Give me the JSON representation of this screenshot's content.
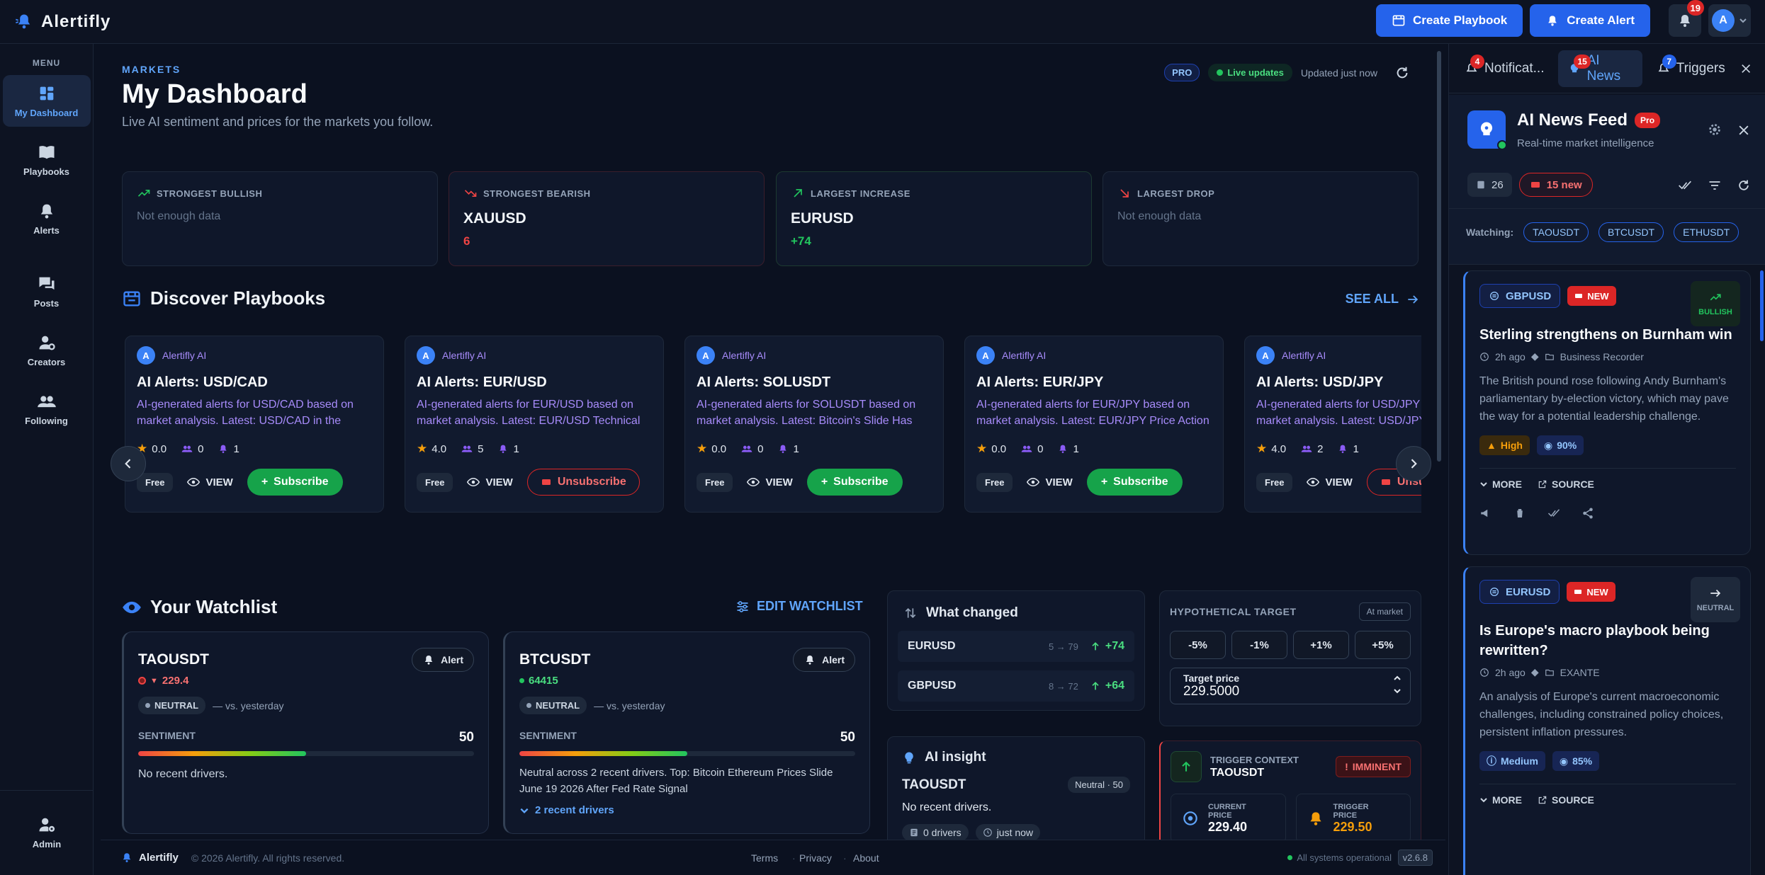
{
  "app": {
    "name": "Alertifly"
  },
  "header": {
    "create_playbook": "Create Playbook",
    "create_alert": "Create Alert",
    "notifications_count": "19",
    "avatar_initial": "A"
  },
  "sidebar": {
    "menu_title": "MENU",
    "items": [
      {
        "label": "My Dashboard"
      },
      {
        "label": "Playbooks"
      },
      {
        "label": "Alerts"
      },
      {
        "label": "Posts"
      },
      {
        "label": "Creators"
      },
      {
        "label": "Following"
      }
    ],
    "admin_label": "Admin"
  },
  "page": {
    "section_label": "MARKETS",
    "title": "My Dashboard",
    "subtitle": "Live AI sentiment and prices for the markets you follow.",
    "pro_badge": "PRO",
    "live_label": "Live updates",
    "updated_label": "Updated just now"
  },
  "stats": [
    {
      "label": "STRONGEST BULLISH",
      "empty": "Not enough data"
    },
    {
      "label": "STRONGEST BEARISH",
      "symbol": "XAUUSD",
      "value": "6"
    },
    {
      "label": "LARGEST INCREASE",
      "symbol": "EURUSD",
      "value": "+74"
    },
    {
      "label": "LARGEST DROP",
      "empty": "Not enough data"
    }
  ],
  "playbooks": {
    "title": "Discover Playbooks",
    "see_all": "SEE ALL",
    "author": "Alertifly AI",
    "author_initial": "A",
    "free_label": "Free",
    "view_label": "VIEW",
    "subscribe_label": "Subscribe",
    "unsubscribe_label": "Unsubscribe",
    "cards": [
      {
        "title": "AI Alerts: USD/CAD",
        "desc": "AI-generated alerts for USD/CAD based on market analysis. Latest: USD/CAD in the Spotlight",
        "rating": "0.0",
        "subs": "0",
        "alerts": "1",
        "action": "subscribe"
      },
      {
        "title": "AI Alerts: EUR/USD",
        "desc": "AI-generated alerts for EUR/USD based on market analysis. Latest: EUR/USD Technical Outlook",
        "rating": "4.0",
        "subs": "5",
        "alerts": "1",
        "action": "unsubscribe"
      },
      {
        "title": "AI Alerts: SOLUSDT",
        "desc": "AI-generated alerts for SOLUSDT based on market analysis. Latest: Bitcoin's Slide Has Traders Watching",
        "rating": "0.0",
        "subs": "0",
        "alerts": "1",
        "action": "subscribe"
      },
      {
        "title": "AI Alerts: EUR/JPY",
        "desc": "AI-generated alerts for EUR/JPY based on market analysis. Latest: EUR/JPY Price Action",
        "rating": "0.0",
        "subs": "0",
        "alerts": "1",
        "action": "subscribe"
      },
      {
        "title": "AI Alerts: USD/JPY",
        "desc": "AI-generated alerts for USD/JPY based on market analysis. Latest: USD/JPY Outlook",
        "rating": "4.0",
        "subs": "2",
        "alerts": "1",
        "action": "unsubscribe"
      }
    ]
  },
  "watchlist": {
    "title": "Your Watchlist",
    "edit_label": "EDIT WATCHLIST",
    "alert_label": "Alert",
    "neutral_label": "NEUTRAL",
    "vs_label": "— vs. yesterday",
    "sentiment_label": "SENTIMENT",
    "items": [
      {
        "symbol": "TAOUSDT",
        "price": "229.4",
        "direction": "down",
        "score": "50",
        "sentiment_fraction": 0.5,
        "text": "No recent drivers.",
        "drivers_link": ""
      },
      {
        "symbol": "BTCUSDT",
        "price": "64415",
        "direction": "live",
        "score": "50",
        "sentiment_fraction": 0.5,
        "text": "Neutral across 2 recent drivers. Top: Bitcoin Ethereum Prices Slide June 19 2026 After Fed Rate Signal",
        "drivers_link": "2 recent drivers"
      }
    ]
  },
  "what_changed": {
    "title": "What changed",
    "rows": [
      {
        "symbol": "EURUSD",
        "range": "5 → 79",
        "delta": "+74"
      },
      {
        "symbol": "GBPUSD",
        "range": "8 → 72",
        "delta": "+64"
      }
    ]
  },
  "hypothetical": {
    "title": "HYPOTHETICAL TARGET",
    "at_market": "At market",
    "buttons": [
      "-5%",
      "-1%",
      "+1%",
      "+5%"
    ],
    "target_label": "Target price",
    "target_value": "229.5000"
  },
  "insight": {
    "title": "AI insight",
    "symbol": "TAOUSDT",
    "badge": "Neutral · 50",
    "text": "No recent drivers.",
    "drivers": "0 drivers",
    "time": "just now"
  },
  "trigger": {
    "context_label": "TRIGGER CONTEXT",
    "symbol": "TAOUSDT",
    "imminent": "IMMINENT",
    "current_label": "CURRENT PRICE",
    "current_value": "229.40",
    "trigger_label": "TRIGGER PRICE",
    "trigger_value": "229.50"
  },
  "footer": {
    "brand": "Alertifly",
    "copyright": "© 2026 Alertifly. All rights reserved.",
    "links": [
      "Terms",
      "Privacy",
      "About"
    ],
    "status": "All systems operational",
    "version": "v2.6.8"
  },
  "right_panel": {
    "tabs": [
      {
        "label": "Notificat...",
        "count": "4"
      },
      {
        "label": "AI News",
        "count": "15"
      },
      {
        "label": "Triggers",
        "count": "7"
      }
    ],
    "feed_title": "AI News Feed",
    "pro_label": "Pro",
    "feed_subtitle": "Real-time market intelligence",
    "total_count": "26",
    "new_count": "15 new",
    "watching_label": "Watching:",
    "watching": [
      "TAOUSDT",
      "BTCUSDT",
      "ETHUSDT"
    ],
    "more_label": "MORE",
    "source_label": "SOURCE",
    "new_label": "NEW",
    "news": [
      {
        "pair": "GBPUSD",
        "sentiment": "BULLISH",
        "title": "Sterling strengthens on Burnham win",
        "time": "2h ago",
        "source": "Business Recorder",
        "body": "The British pound rose following Andy Burnham's parliamentary by-election victory, which may pave the way for a potential leadership challenge.",
        "impact": "High",
        "confidence": "90%"
      },
      {
        "pair": "EURUSD",
        "sentiment": "NEUTRAL",
        "title": "Is Europe's macro playbook being rewritten?",
        "time": "2h ago",
        "source": "EXANTE",
        "body": "An analysis of Europe's current macroeconomic challenges, including constrained policy choices, persistent inflation pressures.",
        "impact": "Medium",
        "confidence": "85%"
      }
    ]
  },
  "colors": {
    "accent": "#2563eb",
    "bullish": "#22c55e",
    "bearish": "#ef4444",
    "warning": "#f59e0b"
  }
}
